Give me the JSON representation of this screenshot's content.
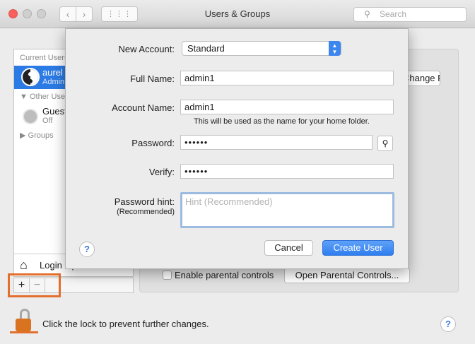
{
  "window": {
    "title": "Users & Groups",
    "search_placeholder": "Search",
    "nav_back": "‹",
    "nav_forward": "›",
    "grid_glyph": "⋮⋮⋮"
  },
  "sidebar": {
    "current_users_header": "Current Users",
    "current_user": {
      "name": "aurel",
      "role": "Admin"
    },
    "other_users_header": "Other Users",
    "guest": {
      "name": "Guest",
      "status": "Off"
    },
    "groups_label": "Groups",
    "login_label": "Login Options",
    "plus_label": "+",
    "minus_label": "−"
  },
  "main": {
    "change_password_label": "Change Password...",
    "enable_parental_label": "Enable parental controls",
    "open_parental_label": "Open Parental Controls...",
    "lock_text": "Click the lock to prevent further changes.",
    "help_label": "?"
  },
  "sheet": {
    "new_account_label": "New Account:",
    "account_type_value": "Standard",
    "full_name_label": "Full Name:",
    "full_name_value": "admin1",
    "account_name_label": "Account Name:",
    "account_name_value": "admin1",
    "account_name_note": "This will be used as the name for your home folder.",
    "password_label": "Password:",
    "password_value": "••••••",
    "verify_label": "Verify:",
    "verify_value": "••••••",
    "hint_label": "Password hint:",
    "hint_sublabel": "(Recommended)",
    "hint_placeholder": "Hint (Recommended)",
    "help_label": "?",
    "cancel_label": "Cancel",
    "create_label": "Create User"
  },
  "colors": {
    "accent": "#2c7be5",
    "highlight": "#e36f2d",
    "lock": "#d9731f"
  },
  "icons": [
    "close-icon",
    "back-icon",
    "forward-icon",
    "grid-icon",
    "search-icon",
    "key-icon",
    "lock-icon",
    "house-icon",
    "help-icon"
  ]
}
